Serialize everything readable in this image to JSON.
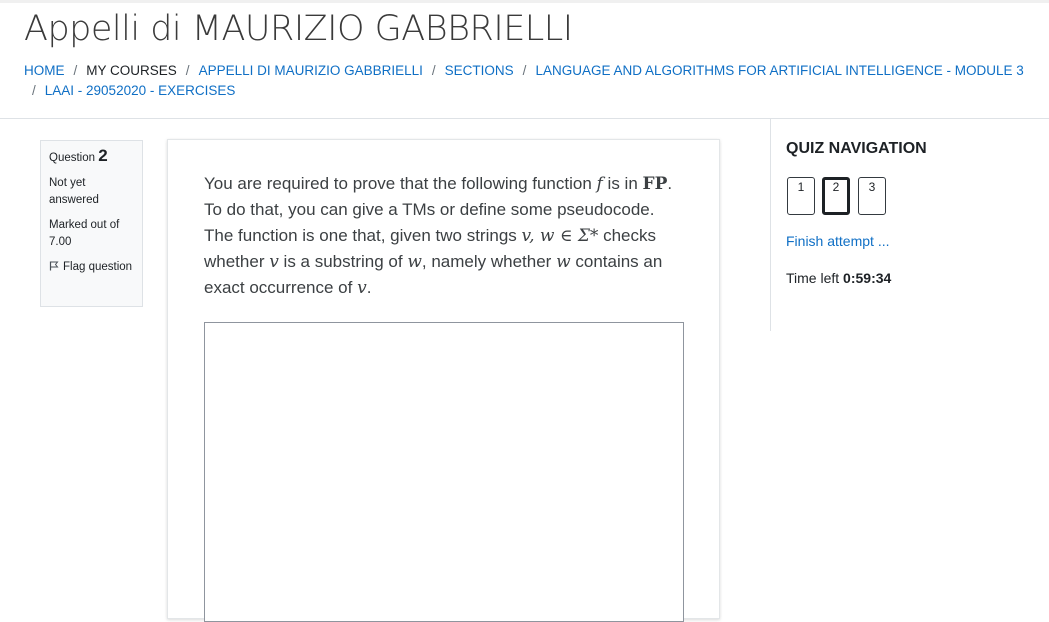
{
  "page": {
    "title": "Appelli di MAURIZIO GABBRIELLI"
  },
  "breadcrumb": {
    "items": [
      "HOME",
      "MY COURSES",
      "APPELLI DI MAURIZIO GABBRIELLI",
      "SECTIONS",
      "LANGUAGE AND ALGORITHMS FOR ARTIFICIAL INTELLIGENCE - MODULE 3",
      "LAAI - 29052020 - EXERCISES"
    ],
    "separator": "/"
  },
  "question_info": {
    "label": "Question",
    "number": "2",
    "status": "Not yet answered",
    "marks": "Marked out of 7.00",
    "flag_label": "Flag question"
  },
  "question": {
    "segments": [
      "You are required to prove that the following function ",
      "f",
      " is in ",
      "FP",
      ". To do that, you can give a TMs or define some pseudocode. The function is one that, given two strings ",
      "v, w ∈ Σ*",
      " checks whether ",
      "v",
      " is a substring of ",
      "w",
      ", namely whether ",
      "w",
      " contains an exact occurrence of ",
      "v",
      "."
    ],
    "answer_value": ""
  },
  "quiz_nav": {
    "title": "QUIZ NAVIGATION",
    "buttons": [
      "1",
      "2",
      "3"
    ],
    "current": "2",
    "finish_label": "Finish attempt ...",
    "time_label": "Time left",
    "time_value": "0:59:34"
  },
  "colors": {
    "link": "#0f6fc5",
    "text": "#1d2125",
    "muted": "#6a737b"
  },
  "icons": {
    "flag": "flag-icon"
  }
}
